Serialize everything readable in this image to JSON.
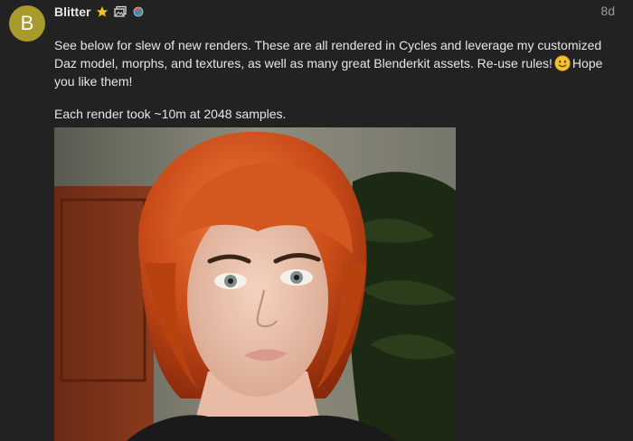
{
  "author": {
    "avatar_letter": "B",
    "avatar_color": "#a99a2e",
    "username": "Blitter",
    "flair_icons": [
      "star-icon",
      "images-icon",
      "globe-icon"
    ]
  },
  "post": {
    "age": "8d",
    "paragraph1_part1": "See below for slew of new renders. These are all rendered in Cycles and leverage my customized Daz model, morphs, and textures, as well as many great Blenderkit assets. Re-use rules!",
    "paragraph1_part2": "Hope you like them!",
    "paragraph2": "Each render took ~10m at 2048 samples.",
    "emoji": "slightly-smiling-face-icon"
  },
  "colors": {
    "background": "#222222",
    "text": "#e6e6e6",
    "muted": "#9a9a9a",
    "star": "#f5c518"
  }
}
